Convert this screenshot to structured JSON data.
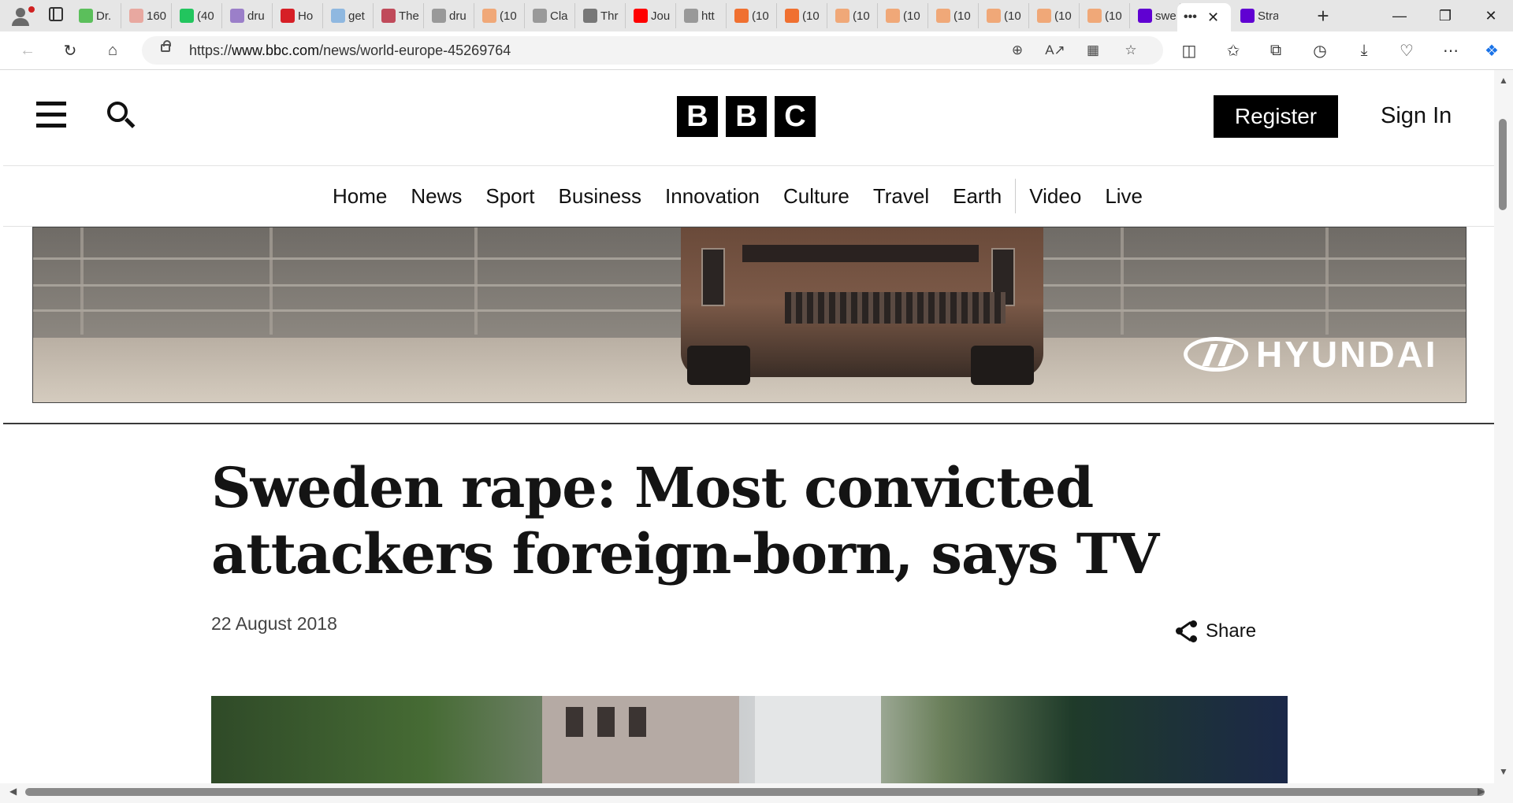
{
  "browser": {
    "tabs": [
      {
        "label": "Dr.",
        "icon": "play-icon",
        "color": "#5bbf5b"
      },
      {
        "label": "160",
        "icon": "bi-icon",
        "color": "#e8a8a0"
      },
      {
        "label": "(40",
        "icon": "g-icon",
        "color": "#22c55e"
      },
      {
        "label": "dru",
        "icon": "yahoo-icon",
        "color": "#9b7fc9"
      },
      {
        "label": "Ho",
        "icon": "ho-icon",
        "color": "#d61f26"
      },
      {
        "label": "get",
        "icon": "search-icon",
        "color": "#8fb8e0"
      },
      {
        "label": "The",
        "icon": "the-icon",
        "color": "#c04a5a"
      },
      {
        "label": "dru",
        "icon": "doc-icon",
        "color": "#999999"
      },
      {
        "label": "(10",
        "icon": "bookmark-icon",
        "color": "#f0a878"
      },
      {
        "label": "Cla",
        "icon": "page-icon",
        "color": "#999999"
      },
      {
        "label": "Thr",
        "icon": "tr-icon",
        "color": "#777777"
      },
      {
        "label": "Jou",
        "icon": "youtube-icon",
        "color": "#ff0000"
      },
      {
        "label": "htt",
        "icon": "page-icon",
        "color": "#999999"
      },
      {
        "label": "(10",
        "icon": "bookmark-icon",
        "color": "#f07030"
      },
      {
        "label": "(10",
        "icon": "bookmark-icon",
        "color": "#f07030"
      },
      {
        "label": "(10",
        "icon": "bookmark-icon",
        "color": "#f0a878"
      },
      {
        "label": "(10",
        "icon": "bookmark-icon",
        "color": "#f0a878"
      },
      {
        "label": "(10",
        "icon": "bookmark-icon",
        "color": "#f0a878"
      },
      {
        "label": "(10",
        "icon": "bookmark-icon",
        "color": "#f0a878"
      },
      {
        "label": "(10",
        "icon": "bookmark-icon",
        "color": "#f0a878"
      },
      {
        "label": "(10",
        "icon": "bookmark-icon",
        "color": "#f0a878"
      },
      {
        "label": "swe",
        "icon": "yahoo-icon",
        "color": "#6001d2"
      }
    ],
    "active_tab": {
      "label": "•••",
      "close": "✕"
    },
    "last_tab": {
      "label": "Stra",
      "icon": "yahoo-icon",
      "color": "#6001d2"
    },
    "url_prefix": "https://",
    "url_host": "www.bbc.com",
    "url_path": "/news/world-europe-45269764",
    "new_tab_symbol": "+"
  },
  "bbc": {
    "logo_letters": [
      "B",
      "B",
      "C"
    ],
    "register_label": "Register",
    "signin_label": "Sign In",
    "nav": [
      "Home",
      "News",
      "Sport",
      "Business",
      "Innovation",
      "Culture",
      "Travel",
      "Earth",
      "Video",
      "Live"
    ]
  },
  "ad": {
    "brand": "HYUNDAI"
  },
  "article": {
    "headline": "Sweden rape: Most convicted attackers foreign-born, says TV",
    "date": "22 August 2018",
    "share_label": "Share"
  }
}
